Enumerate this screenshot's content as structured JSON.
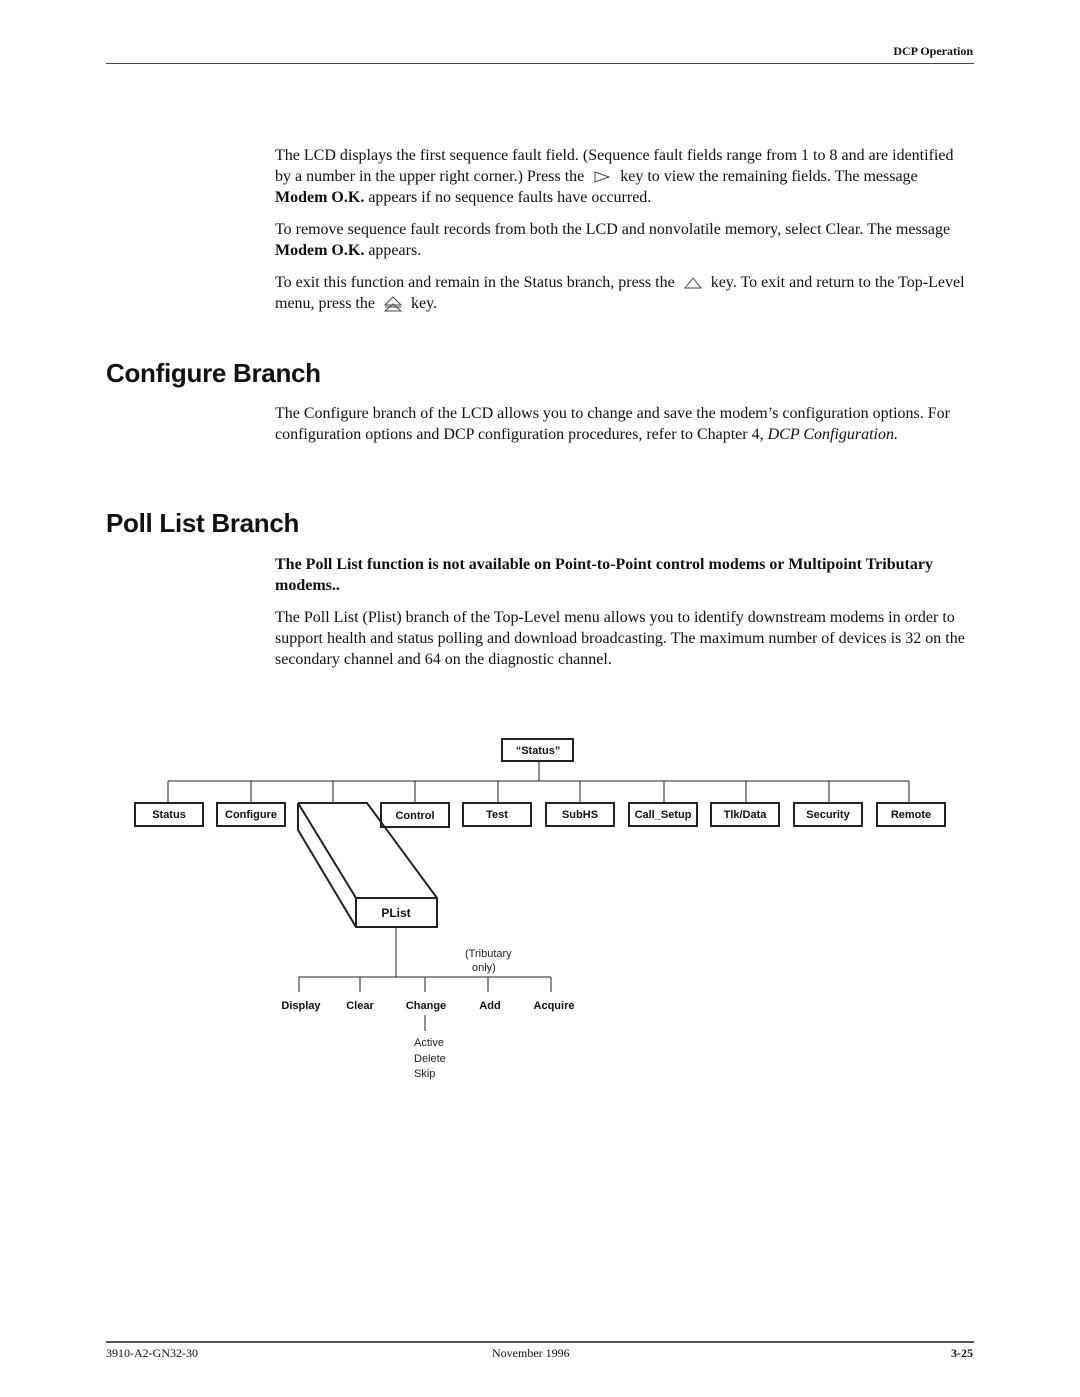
{
  "header": {
    "section_title": "DCP Operation"
  },
  "intro": {
    "p1_a": "The LCD displays the first sequence fault field. (Sequence fault fields range from 1 to 8 and are identified by a number in the upper right corner.) Press the",
    "p1_b": "key to view the remaining fields. The message",
    "p1_bold": "Modem O.K.",
    "p1_c": "appears if no sequence faults have occurred.",
    "p2_a": "To remove sequence fault records from both the LCD and nonvolatile memory, select Clear. The message",
    "p2_bold": "Modem O.K.",
    "p2_c": "appears.",
    "p3_a": "To exit this function and remain in the Status branch, press the",
    "p3_b": "key. To exit and return to the Top-Level menu, press the",
    "p3_c": "key.",
    "icons": [
      "right-arrow-key-icon",
      "up-arrow-key-icon",
      "top-level-key-icon"
    ]
  },
  "configure": {
    "heading": "Configure Branch",
    "text_a": "The Configure branch of the LCD allows you to change and save the modem’s configuration options. For configuration options and DCP configuration procedures, refer to Chapter 4,",
    "text_italic": "DCP Configuration."
  },
  "poll_list": {
    "heading": "Poll List Branch",
    "warning": "The Poll List function is not available on Point-to-Point control modems or Multipoint Tributary modems..",
    "text": "The Poll List (Plist) branch of the Top-Level menu allows you to identify downstream modems in order to support health and status polling and download broadcasting. The maximum number of devices is 32 on the secondary channel and 64 on the diagnostic channel."
  },
  "diagram": {
    "root": "“Status”",
    "top_menu": [
      "Status",
      "Configure",
      "Control",
      "Test",
      "SubHS",
      "Call_Setup",
      "Tlk/Data",
      "Security",
      "Remote"
    ],
    "highlighted": "PList",
    "note_line1": "(Tributary",
    "note_line2": "only)",
    "plist_children": [
      "Display",
      "Clear",
      "Change",
      "Add",
      "Acquire"
    ],
    "change_options": [
      "Active",
      "Delete",
      "Skip"
    ]
  },
  "footer": {
    "doc_number": "3910-A2-GN32-30",
    "date": "November 1996",
    "page": "3-25"
  }
}
